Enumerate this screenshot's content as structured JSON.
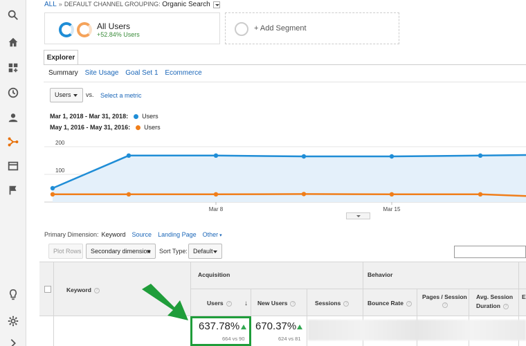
{
  "breadcrumb": {
    "root": "ALL",
    "separator": "»",
    "grouping": "DEFAULT CHANNEL GROUPING:",
    "current": "Organic Search"
  },
  "segments": {
    "all_users": {
      "name": "All Users",
      "change": "+52.84% Users"
    },
    "add_label": "+ Add Segment"
  },
  "tabs": {
    "explorer": "Explorer"
  },
  "subtabs": [
    "Summary",
    "Site Usage",
    "Goal Set 1",
    "Ecommerce"
  ],
  "metric": {
    "selected": "Users",
    "vs_label": "vs.",
    "select_link": "Select a metric"
  },
  "legend": [
    {
      "range": "Mar 1, 2018 - Mar 31, 2018:",
      "metric": "Users",
      "color": "#1f8dd6"
    },
    {
      "range": "May 1, 2016 - May 31, 2016:",
      "metric": "Users",
      "color": "#f07e1a"
    }
  ],
  "chart_data": {
    "type": "area",
    "y_ticks": [
      "200",
      "100"
    ],
    "x_ticks": [
      "Mar 8",
      "Mar 15"
    ],
    "ylim": [
      0,
      235
    ],
    "grid": true,
    "series": [
      {
        "name": "Mar 1, 2018 - Mar 31, 2018",
        "color": "#1f8dd6",
        "values": [
          50,
          168,
          168,
          165,
          165,
          168,
          170
        ]
      },
      {
        "name": "May 1, 2016 - May 31, 2016",
        "color": "#f07e1a",
        "values": [
          28,
          28,
          28,
          29,
          28,
          28,
          22
        ]
      }
    ]
  },
  "primary_dimension": {
    "label": "Primary Dimension:",
    "active": "Keyword",
    "options": [
      "Source",
      "Landing Page",
      "Other"
    ]
  },
  "toolbar": {
    "plot_rows": "Plot Rows",
    "secondary": "Secondary dimension",
    "sort_label": "Sort Type:",
    "sort_value": "Default"
  },
  "table": {
    "col_keyword": "Keyword",
    "group_acquisition": "Acquisition",
    "group_behavior": "Behavior",
    "col_users": "Users",
    "col_new_users": "New Users",
    "col_sessions": "Sessions",
    "col_bounce": "Bounce Rate",
    "col_pages_line1": "Pages / Session",
    "col_avg_line1": "Avg. Session",
    "col_avg_line2": "Duration",
    "col_e": "E",
    "summary": {
      "users_pct": "637.78%",
      "users_cmp": "664 vs 90",
      "new_users_pct": "670.37%",
      "new_users_cmp": "624 vs 81"
    }
  },
  "colors": {
    "accent_blue": "#1a66b8",
    "highlight_green": "#1f9d3a",
    "up_green": "#34a853"
  }
}
